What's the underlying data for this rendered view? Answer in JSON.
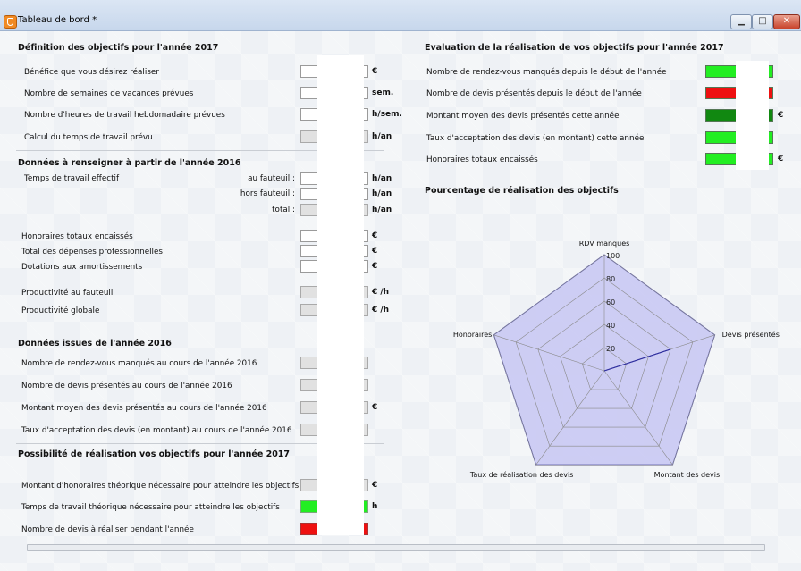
{
  "window": {
    "title": "Tableau de bord *",
    "minimize_icon": "minimize-icon",
    "maximize_icon": "maximize-icon",
    "close_icon": "close-icon"
  },
  "left": {
    "s1": {
      "title": "Définition des objectifs pour l'année 2017",
      "rows": [
        {
          "label": "Bénéfice que vous désirez réaliser",
          "unit": "€"
        },
        {
          "label": "Nombre de semaines de vacances prévues",
          "unit": "sem."
        },
        {
          "label": "Nombre d'heures de travail hebdomadaire prévues",
          "unit": "h/sem."
        },
        {
          "label": "Calcul du temps de travail prévu",
          "unit": "h/an"
        }
      ]
    },
    "s2": {
      "title": "Données à renseigner à partir de l'année 2016",
      "work_label": "Temps de travail effectif",
      "sub": [
        {
          "label": "au fauteuil :",
          "unit": "h/an"
        },
        {
          "label": "hors fauteuil :",
          "unit": "h/an"
        },
        {
          "label": "total :",
          "unit": "h/an"
        }
      ],
      "rows": [
        {
          "label": "Honoraires totaux encaissés",
          "unit": "€"
        },
        {
          "label": "Total  des dépenses professionnelles",
          "unit": "€"
        },
        {
          "label": "Dotations aux amortissements",
          "unit": "€"
        },
        {
          "label": "Productivité au fauteuil",
          "unit": "€ /h"
        },
        {
          "label": "Productivité globale",
          "unit": "€ /h"
        }
      ]
    },
    "s3": {
      "title": "Données issues de l'année  2016",
      "rows": [
        {
          "label": "Nombre de rendez-vous manqués au cours de l'année 2016",
          "unit": ""
        },
        {
          "label": "Nombre de devis présentés au cours de l'année 2016",
          "unit": ""
        },
        {
          "label": "Montant moyen des devis présentés au cours de l'année 2016",
          "unit": "€"
        },
        {
          "label": "Taux d'acceptation des devis (en montant) au cours de l'année 2016",
          "unit": ""
        }
      ]
    },
    "s4": {
      "title": "Possibilité de réalisation vos objectifs pour l'année 2017",
      "rows": [
        {
          "label": "Montant d'honoraires théorique nécessaire pour atteindre les objectifs",
          "unit": "€"
        },
        {
          "label": "Temps de travail théorique nécessaire pour atteindre les objectifs",
          "unit": "h"
        },
        {
          "label": "Nombre de devis à réaliser pendant l'année",
          "unit": ""
        }
      ]
    }
  },
  "right": {
    "title": "Evaluation de la réalisation de vos objectifs pour l'année 2017",
    "rows": [
      {
        "label": "Nombre de rendez-vous manqués depuis le début de l'année",
        "unit": "",
        "status_color": "#22ee22"
      },
      {
        "label": "Nombre de devis présentés depuis le début de l'année",
        "unit": "",
        "status_color": "#ee1111"
      },
      {
        "label": "Montant moyen des devis présentés cette année",
        "unit": "€",
        "status_color": "#118811"
      },
      {
        "label": "Taux d'acceptation des devis (en montant) cette année",
        "unit": "",
        "status_color": "#22ee22"
      },
      {
        "label": "Honoraires totaux encaissés",
        "unit": "€",
        "status_color": "#22ee22"
      }
    ],
    "chart_title": "Pourcentage de réalisation des objectifs"
  },
  "chart_data": {
    "type": "radar",
    "axes": [
      "RDV manqués",
      "Devis présentés",
      "Montant des devis",
      "Taux de réalisation des devis",
      "Honoraires"
    ],
    "ticks": [
      "20",
      "40",
      "60",
      "80",
      "100"
    ],
    "series": [
      {
        "values": [
          100,
          100,
          100,
          100,
          100
        ],
        "fill": "#c9c9f3",
        "stroke": "#4b4bb5"
      },
      {
        "values": [
          0,
          60,
          0,
          0,
          0
        ],
        "fill": "none",
        "stroke": "#3030a0"
      }
    ],
    "rmax": 100,
    "grid": true
  }
}
